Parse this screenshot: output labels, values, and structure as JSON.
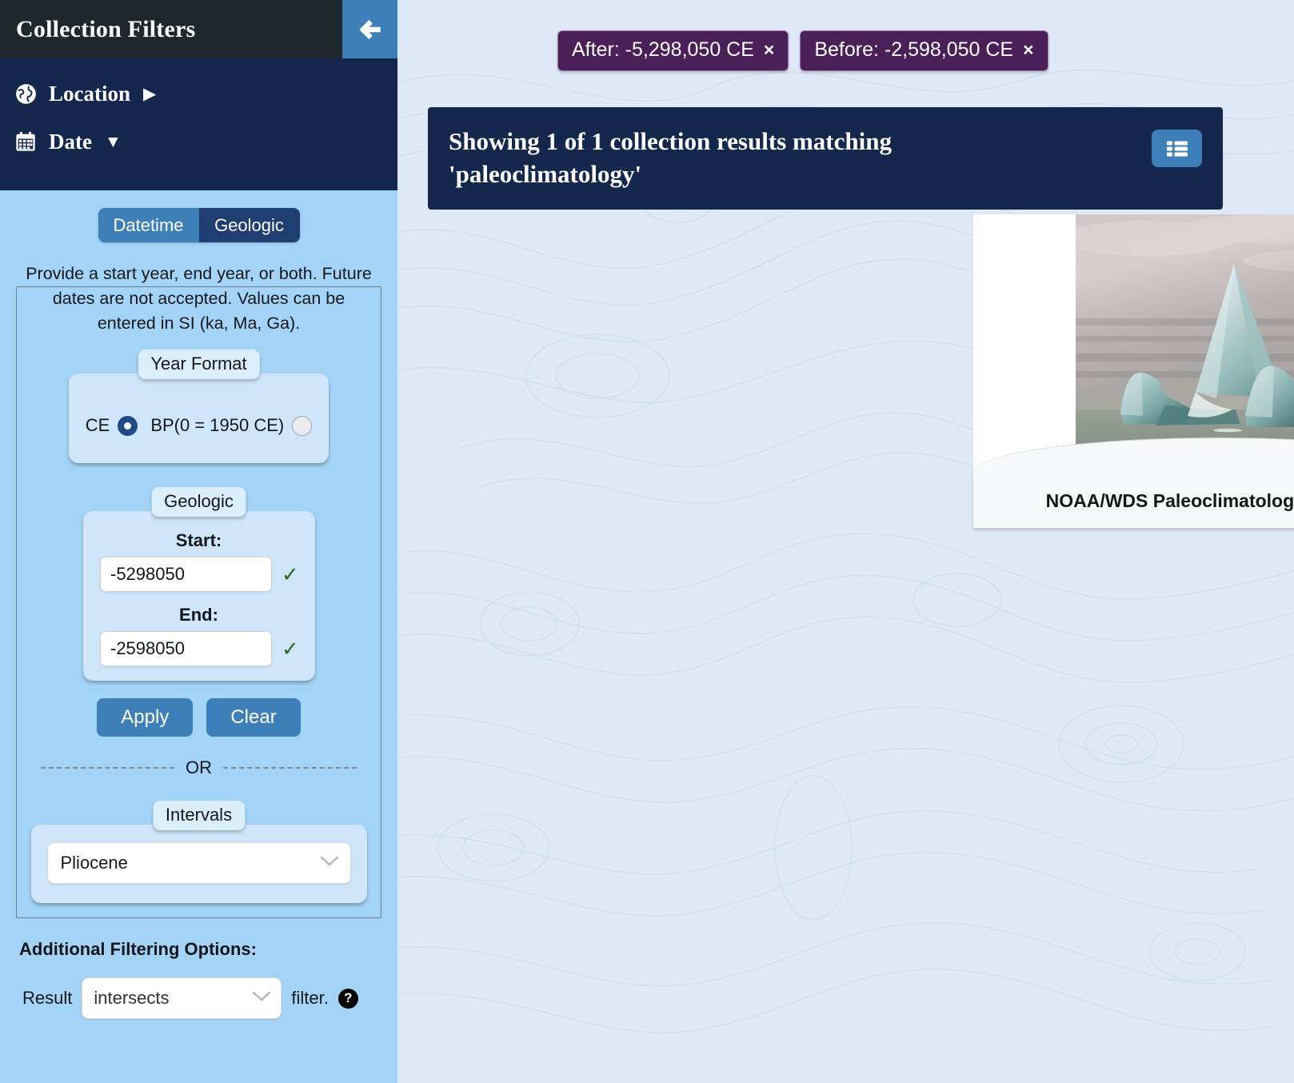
{
  "sidebar": {
    "title": "Collection Filters",
    "collapse_icon": "arrow-left-icon",
    "nav": [
      {
        "label": "Location",
        "icon": "globe-icon",
        "caret": "▶",
        "expanded": false
      },
      {
        "label": "Date",
        "icon": "calendar-icon",
        "caret": "▼",
        "expanded": true
      }
    ],
    "mode_toggle": {
      "options": [
        "Datetime",
        "Geologic"
      ],
      "selected": "Geologic"
    },
    "help_text": "Provide a start year, end year, or both. Future dates are not accepted. Values can be entered in SI (ka, Ma, Ga).",
    "year_format": {
      "legend": "Year Format",
      "options": [
        {
          "label": "CE",
          "checked": true
        },
        {
          "label": "BP(0 = 1950 CE)",
          "checked": false
        }
      ]
    },
    "geologic": {
      "legend": "Geologic",
      "start_label": "Start:",
      "start_value": "-5298050",
      "start_valid_icon": "✓",
      "end_label": "End:",
      "end_value": "-2598050",
      "end_valid_icon": "✓"
    },
    "buttons": {
      "apply": "Apply",
      "clear": "Clear"
    },
    "or_text": "OR",
    "intervals": {
      "legend": "Intervals",
      "selected": "Pliocene"
    },
    "additional": {
      "title": "Additional Filtering Options:",
      "result_label": "Result",
      "result_selected": "intersects",
      "filter_label": "filter.",
      "help_icon": "question-mark-icon"
    }
  },
  "main": {
    "chips": [
      {
        "label": "After: -5,298,050 CE",
        "close": "×"
      },
      {
        "label": "Before: -2,598,050 CE",
        "close": "×"
      }
    ],
    "results_header": {
      "text": "Showing 1 of 1 collection results matching 'paleoclimatology'",
      "view_toggle_icon": "list-view-icon"
    },
    "result_card": {
      "caption": "NOAA/WDS Paleoclimatology - A global",
      "thumbnail_alt": "iceberg-photo"
    }
  },
  "colors": {
    "sidebar_bg": "#a3d4f7",
    "nav_bg": "#14284d",
    "header_bg": "#22272e",
    "accent_blue": "#3d7fb8",
    "active_navy": "#1f3f73",
    "chip_purple": "#4b1f58",
    "main_bg": "#dfe8f7",
    "check_green": "#2f6b18"
  }
}
